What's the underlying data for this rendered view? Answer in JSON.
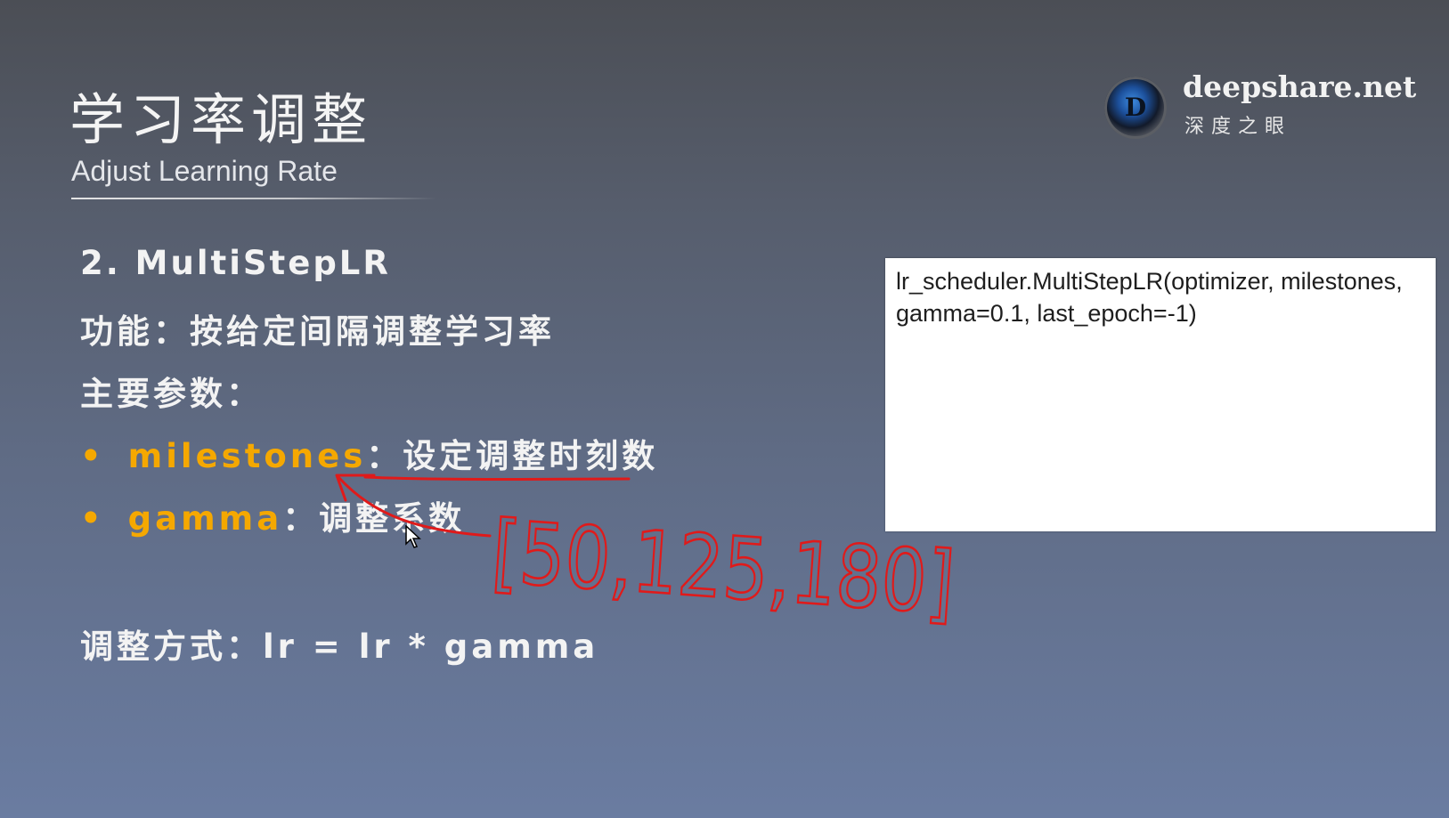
{
  "slide": {
    "title_cn": "学习率调整",
    "title_en": "Adjust Learning Rate",
    "logo": {
      "site": "deepshare.net",
      "subtitle": "深度之眼",
      "glyph": "D"
    },
    "heading": "2. MultiStepLR",
    "function_line": "功能：按给定间隔调整学习率",
    "params_label": "主要参数：",
    "params": [
      {
        "name": "milestones",
        "desc": "：设定调整时刻数"
      },
      {
        "name": "gamma",
        "desc": "：调整系数"
      }
    ],
    "adjust_line": "调整方式：lr = lr * gamma",
    "code": "lr_scheduler.MultiStepLR(optimizer, milestones, gamma=0.1, last_epoch=-1)",
    "annotation": "[50,125,180]"
  },
  "colors": {
    "accent": "#f5a800",
    "annotation": "#e01a1a"
  }
}
